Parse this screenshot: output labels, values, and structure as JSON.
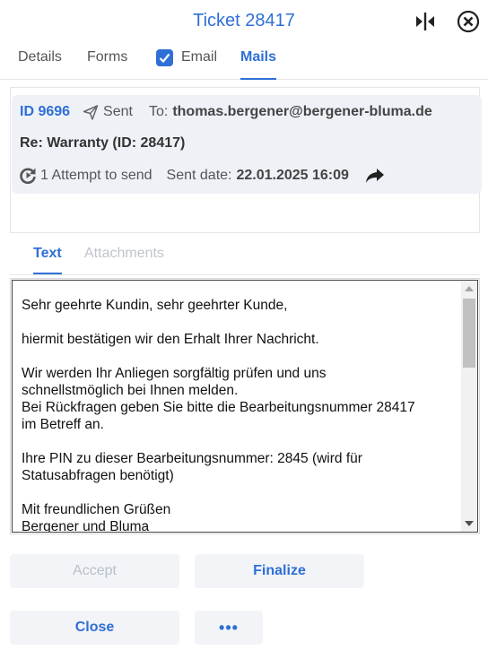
{
  "header": {
    "title": "Ticket 28417",
    "icons": [
      "split-view-icon",
      "close-circle-icon"
    ]
  },
  "tabs": [
    {
      "label": "Details",
      "active": false
    },
    {
      "label": "Forms",
      "active": false
    },
    {
      "label": "Email",
      "checked": true,
      "active": false
    },
    {
      "label": "Mails",
      "active": true
    }
  ],
  "mail": {
    "id": "ID 9696",
    "status": "Sent",
    "to_label": "To:",
    "to_address": "thomas.bergener@bergener-bluma.de",
    "subject": "Re: Warranty (ID: 28417)",
    "attempts": "1 Attempt to send",
    "sent_date_label": "Sent date:",
    "sent_date": "22.01.2025 16:09"
  },
  "subtabs": [
    {
      "label": "Text",
      "active": true
    },
    {
      "label": "Attachments",
      "active": false
    }
  ],
  "body_text": {
    "p1": "Sehr geehrte Kundin, sehr geehrter Kunde,",
    "p2": "hiermit bestätigen wir den Erhalt Ihrer Nachricht.",
    "p3": "Wir werden Ihr Anliegen sorgfältig prüfen und uns\nschnellstmöglich bei Ihnen melden.\nBei Rückfragen geben Sie bitte die Bearbeitungsnummer 28417\nim Betreff an.",
    "p4": "Ihre PIN zu dieser Bearbeitungsnummer: 2845 (wird für\nStatusabfragen benötigt)",
    "p5": "Mit freundlichen Grüßen\nBergener und Bluma"
  },
  "buttons": {
    "accept": "Accept",
    "finalize": "Finalize",
    "close": "Close",
    "more": "•••"
  },
  "colors": {
    "accent": "#2f6fd6",
    "panel_bg": "#eef2f7",
    "button_bg": "#f2f4f7",
    "disabled_text": "#b9c0cb"
  }
}
